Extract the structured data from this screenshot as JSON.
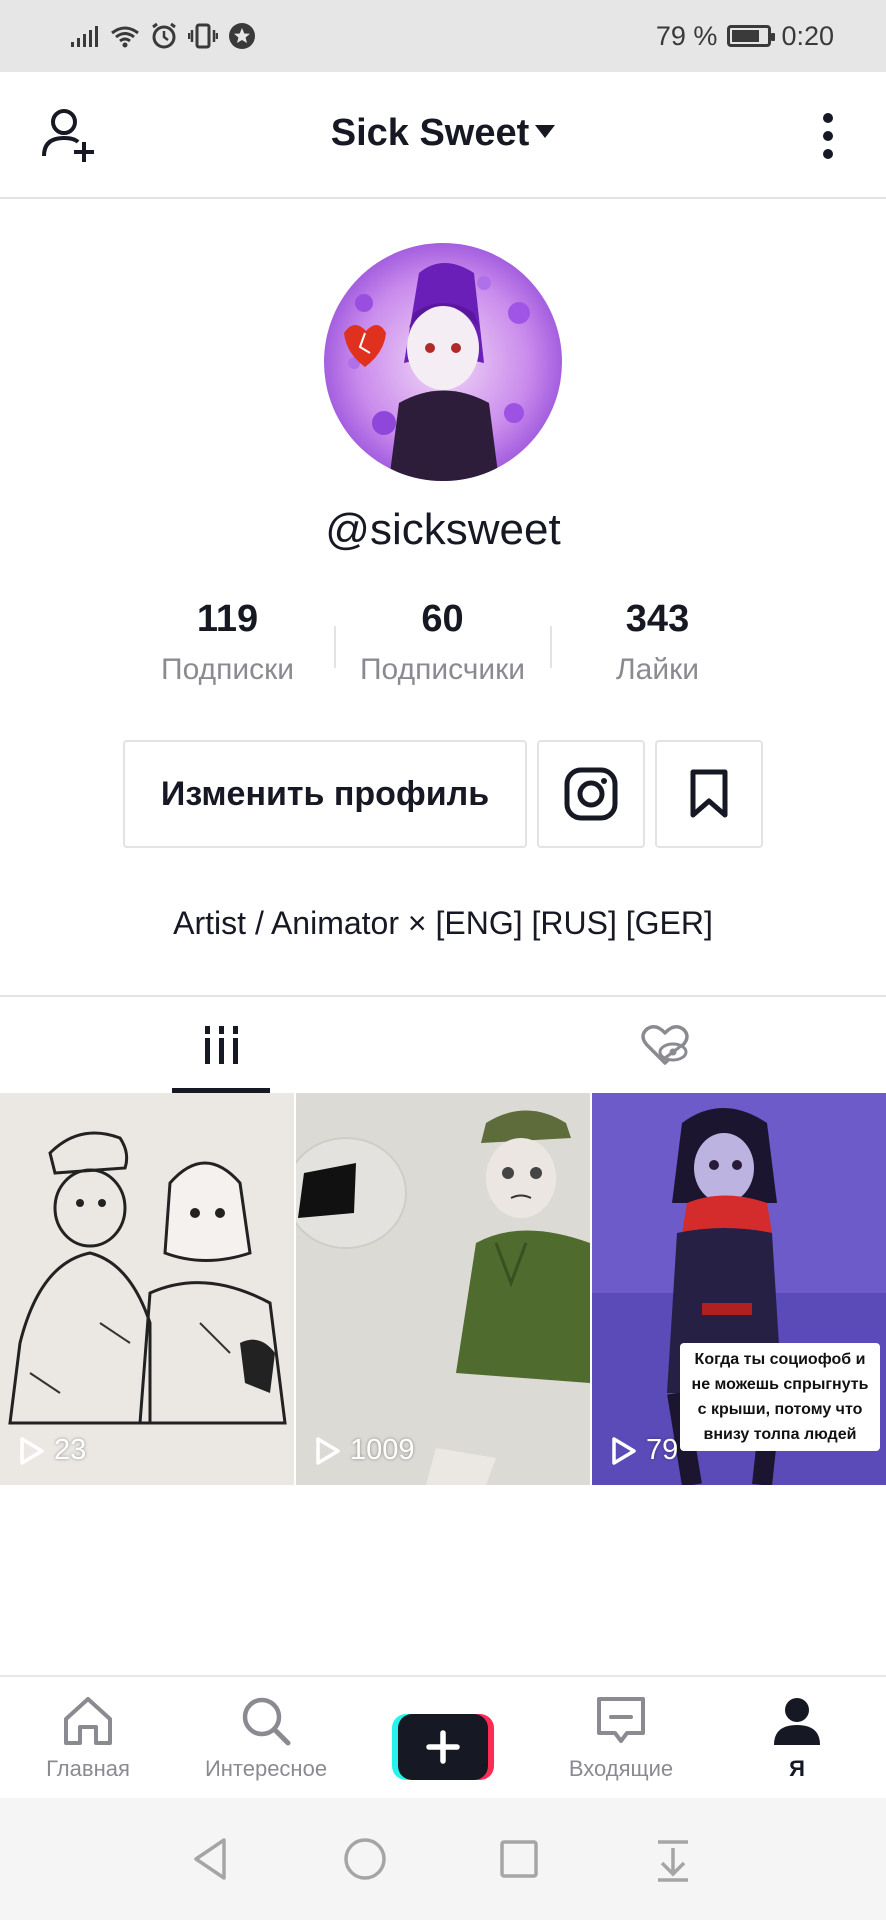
{
  "status_bar": {
    "battery": "79 %",
    "time": "0:20",
    "battery_level": 0.79,
    "icons": [
      "signal-icon",
      "wifi-icon",
      "alarm-icon",
      "vibrate-icon",
      "notification-star-icon"
    ]
  },
  "header": {
    "title": "Sick Sweet"
  },
  "profile": {
    "username": "@sicksweet",
    "stats": [
      {
        "value": "119",
        "label": "Подписки"
      },
      {
        "value": "60",
        "label": "Подписчики"
      },
      {
        "value": "343",
        "label": "Лайки"
      }
    ],
    "edit_button": "Изменить профиль",
    "bio": "Artist / Animator × [ENG] [RUS] [GER]"
  },
  "videos": [
    {
      "views": "23"
    },
    {
      "views": "1009"
    },
    {
      "views": "79",
      "caption": "Когда ты социофоб и не можешь спрыгнуть с крыши, потому что внизу толпа людей"
    }
  ],
  "bottom_nav": {
    "items": [
      {
        "label": "Главная",
        "icon": "home-icon"
      },
      {
        "label": "Интересное",
        "icon": "search-icon"
      },
      {
        "label": "",
        "icon": "create-plus-icon"
      },
      {
        "label": "Входящие",
        "icon": "inbox-icon"
      },
      {
        "label": "Я",
        "icon": "profile-icon"
      }
    ]
  },
  "colors": {
    "text": "#161823",
    "muted": "#8a8b91",
    "border": "#e3e3e4",
    "accent_cyan": "#25f4ee",
    "accent_red": "#fe2c55"
  }
}
